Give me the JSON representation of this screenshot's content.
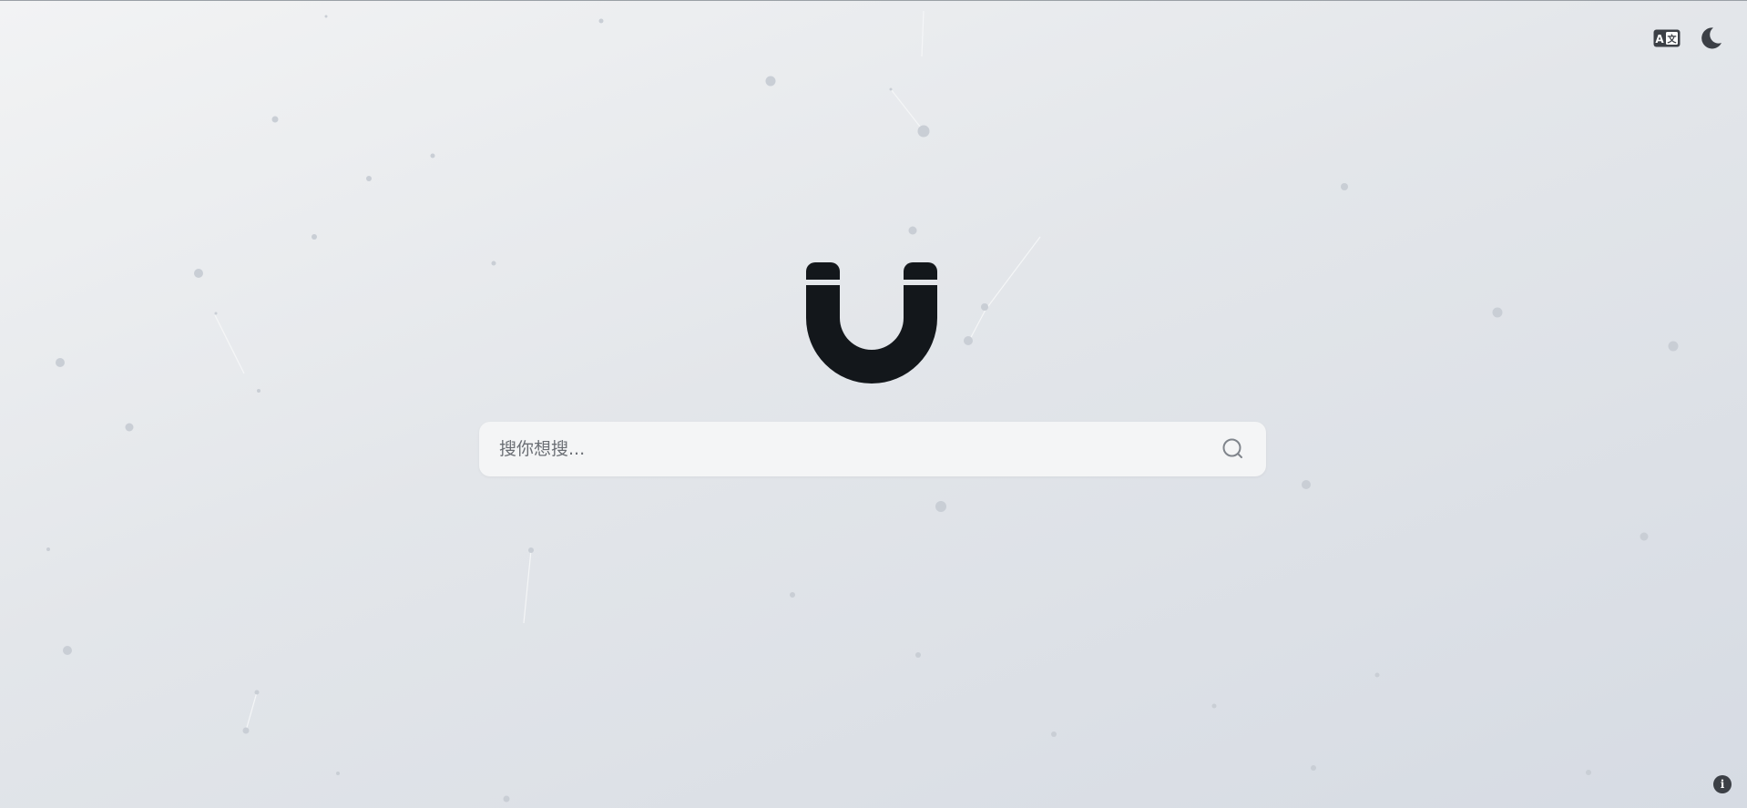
{
  "header": {
    "translate_icon": "translate-icon",
    "theme_icon": "moon-icon"
  },
  "logo": {
    "icon": "magnet-logo",
    "color": "#13171b"
  },
  "search": {
    "placeholder": "搜你想搜...",
    "value": "",
    "icon": "search-icon"
  },
  "footer": {
    "info_icon": "info-icon",
    "info_glyph": "i"
  },
  "colors": {
    "background_start": "#f2f3f4",
    "background_end": "#d6dbe3",
    "particle": "#c9ced5",
    "search_bg": "#f4f5f6",
    "icon_dark": "#3c4046"
  }
}
